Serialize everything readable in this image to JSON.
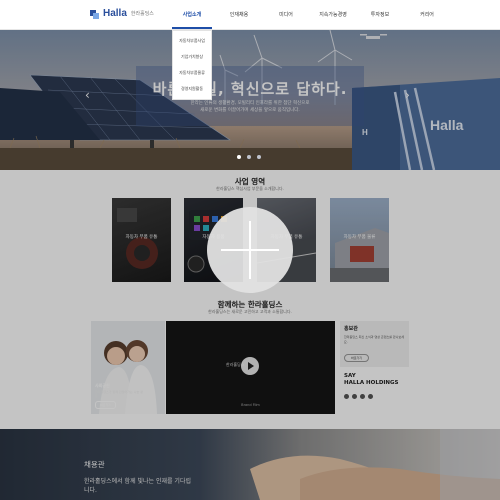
{
  "header": {
    "logo_text": "Halla",
    "logo_sub": "한라홀딩스",
    "nav": [
      "사업소개",
      "인재채용",
      "미디어",
      "지속가능경영",
      "투자정보",
      "커리어"
    ]
  },
  "dropdown": [
    "자동차부품사업",
    "기업가치향상",
    "자동차부품물류",
    "경영지원활동"
  ],
  "hero": {
    "title": "바른 내일, 혁신으로 답하다.",
    "desc_line1": "한라는 인류의 생활환경, 모빌리티 인프라를 위한 첨단 혁신으로",
    "desc_line2": "새로운 변화를 이끌어가며 세상을 앞으로 움직입니다.",
    "truck_brand": "Halla",
    "slides_total": 3,
    "slide_current": 1
  },
  "business": {
    "title": "사업 영역",
    "subtitle": "한라홀딩스 핵심사업 부문을 소개합니다.",
    "cards": [
      "자동차 부품 유통",
      "자동차 용품",
      "자동차 부품 유통",
      "자동차 부품 물류"
    ]
  },
  "together": {
    "title": "함께하는 한라홀딩스",
    "subtitle": "한라홀딩스는 새로운 고민하고 고객과 소통합니다.",
    "mom_label": "사회공헌",
    "mom_desc": "한라홀딩스가 함께 만들어가는 나눔 활동",
    "mom_btn": "바로가기",
    "video_logo": "한라홀딩스",
    "video_label": "Brand Film",
    "pr_title": "홍보관",
    "pr_desc": "한라홀딩스 최신 소식과 영상 콘텐츠를 만나보세요.",
    "pr_btn": "바로가기",
    "say_line1": "SAY",
    "say_line2": "HALLA HOLDINGS"
  },
  "recruit": {
    "title": "채용관",
    "desc": "한라홀딩스에서 함께 빛나는 인재를 기다립니다."
  }
}
